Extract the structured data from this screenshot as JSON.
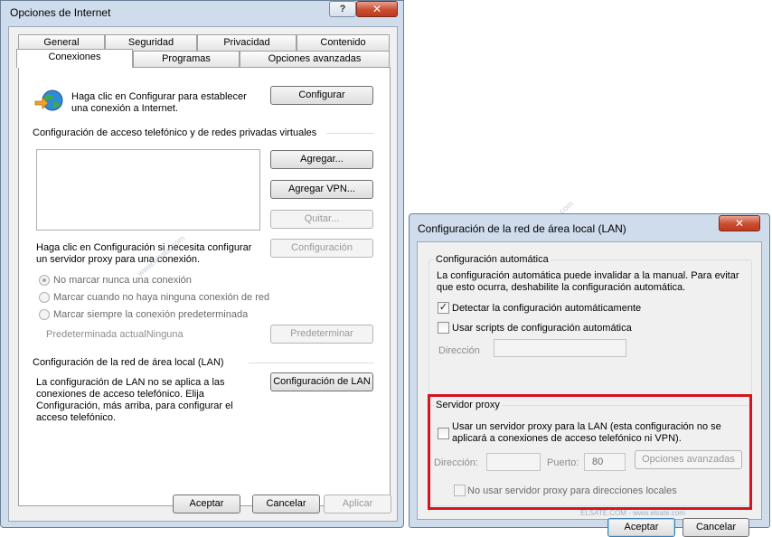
{
  "internet_options": {
    "title": "Opciones de Internet",
    "help_button": "?",
    "close_button": "✕",
    "tabs_back": [
      "General",
      "Seguridad",
      "Privacidad",
      "Contenido"
    ],
    "tabs_front": [
      "Conexiones",
      "Programas",
      "Opciones avanzadas"
    ],
    "active_tab": "Conexiones",
    "setup_text_line1": "Haga clic en Configurar para establecer",
    "setup_text_line2": "una conexión a Internet.",
    "setup_button": "Configurar",
    "dialup_section_label": "Configuración de acceso telefónico y de redes privadas virtuales",
    "add_button": "Agregar...",
    "add_vpn_button": "Agregar VPN...",
    "remove_button": "Quitar...",
    "settings_button": "Configuración",
    "proxy_hint_line1": "Haga clic en Configuración si necesita configurar",
    "proxy_hint_line2": "un servidor proxy para una conexión.",
    "radio_never": "No marcar nunca una conexión",
    "radio_no_network": "Marcar cuando no haya ninguna conexión de red",
    "radio_always": "Marcar siempre la conexión predeterminada",
    "current_default_label": "Predeterminada actual",
    "current_default_value": "Ninguna",
    "set_default_button": "Predeterminar",
    "lan_section_label": "Configuración de la red de área local (LAN)",
    "lan_text_line1": "La configuración de LAN no se aplica a las",
    "lan_text_line2": "conexiones de acceso telefónico. Elija",
    "lan_text_line3": "Configuración, más arriba, para configurar el",
    "lan_text_line4": "acceso telefónico.",
    "lan_settings_button": "Configuración de LAN",
    "ok_button": "Aceptar",
    "cancel_button": "Cancelar",
    "apply_button": "Aplicar"
  },
  "lan_settings": {
    "title": "Configuración de la red de área local (LAN)",
    "close_button": "✕",
    "auto_group_label": "Configuración automática",
    "auto_desc_line1": "La configuración automática puede invalidar a la manual. Para evitar",
    "auto_desc_line2": "que esto ocurra, deshabilite la configuración automática.",
    "auto_detect_label": "Detectar la configuración automáticamente",
    "auto_detect_checked": true,
    "auto_script_label": "Usar scripts de configuración automática",
    "auto_script_checked": false,
    "address_label": "Dirección",
    "address_value": "",
    "proxy_group_label": "Servidor proxy",
    "proxy_use_line1": "Usar un servidor proxy para la LAN (esta configuración no se",
    "proxy_use_line2": "aplicará a conexiones de acceso telefónico ni VPN).",
    "proxy_use_checked": false,
    "proxy_address_label": "Dirección:",
    "proxy_address_value": "",
    "proxy_port_label": "Puerto:",
    "proxy_port_value": "80",
    "advanced_button": "Opciones avanzadas",
    "bypass_local_label": "No usar servidor proxy para direcciones locales",
    "ok_button": "Aceptar",
    "cancel_button": "Cancelar"
  },
  "watermarks": [
    "www.elsate.com",
    "www.elsate.com",
    "ELSATE.COM - www.elsate.com"
  ],
  "colors": {
    "window_frame": "#cfdcec",
    "highlight_box": "#d4141f",
    "page_bg": "#ffffff",
    "dialog_bg": "#f0f0f0"
  }
}
